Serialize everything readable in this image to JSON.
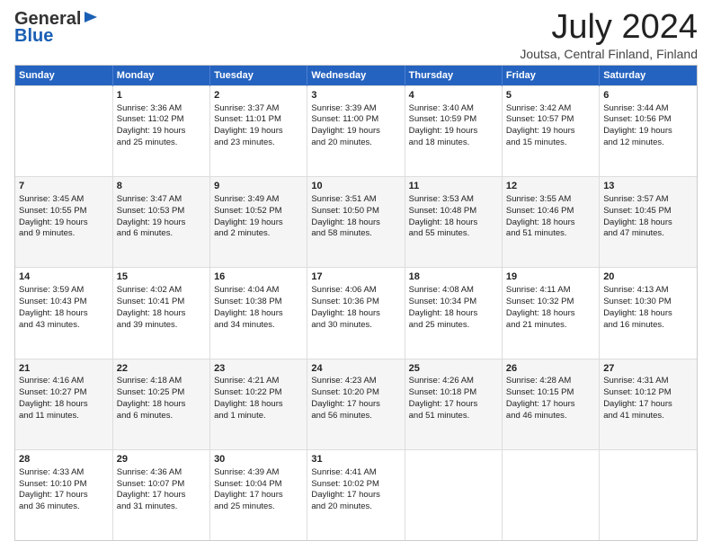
{
  "header": {
    "logo_line1": "General",
    "logo_line2": "Blue",
    "month": "July 2024",
    "location": "Joutsa, Central Finland, Finland"
  },
  "weekdays": [
    "Sunday",
    "Monday",
    "Tuesday",
    "Wednesday",
    "Thursday",
    "Friday",
    "Saturday"
  ],
  "weeks": [
    [
      {
        "day": "",
        "lines": []
      },
      {
        "day": "1",
        "lines": [
          "Sunrise: 3:36 AM",
          "Sunset: 11:02 PM",
          "Daylight: 19 hours",
          "and 25 minutes."
        ]
      },
      {
        "day": "2",
        "lines": [
          "Sunrise: 3:37 AM",
          "Sunset: 11:01 PM",
          "Daylight: 19 hours",
          "and 23 minutes."
        ]
      },
      {
        "day": "3",
        "lines": [
          "Sunrise: 3:39 AM",
          "Sunset: 11:00 PM",
          "Daylight: 19 hours",
          "and 20 minutes."
        ]
      },
      {
        "day": "4",
        "lines": [
          "Sunrise: 3:40 AM",
          "Sunset: 10:59 PM",
          "Daylight: 19 hours",
          "and 18 minutes."
        ]
      },
      {
        "day": "5",
        "lines": [
          "Sunrise: 3:42 AM",
          "Sunset: 10:57 PM",
          "Daylight: 19 hours",
          "and 15 minutes."
        ]
      },
      {
        "day": "6",
        "lines": [
          "Sunrise: 3:44 AM",
          "Sunset: 10:56 PM",
          "Daylight: 19 hours",
          "and 12 minutes."
        ]
      }
    ],
    [
      {
        "day": "7",
        "lines": [
          "Sunrise: 3:45 AM",
          "Sunset: 10:55 PM",
          "Daylight: 19 hours",
          "and 9 minutes."
        ]
      },
      {
        "day": "8",
        "lines": [
          "Sunrise: 3:47 AM",
          "Sunset: 10:53 PM",
          "Daylight: 19 hours",
          "and 6 minutes."
        ]
      },
      {
        "day": "9",
        "lines": [
          "Sunrise: 3:49 AM",
          "Sunset: 10:52 PM",
          "Daylight: 19 hours",
          "and 2 minutes."
        ]
      },
      {
        "day": "10",
        "lines": [
          "Sunrise: 3:51 AM",
          "Sunset: 10:50 PM",
          "Daylight: 18 hours",
          "and 58 minutes."
        ]
      },
      {
        "day": "11",
        "lines": [
          "Sunrise: 3:53 AM",
          "Sunset: 10:48 PM",
          "Daylight: 18 hours",
          "and 55 minutes."
        ]
      },
      {
        "day": "12",
        "lines": [
          "Sunrise: 3:55 AM",
          "Sunset: 10:46 PM",
          "Daylight: 18 hours",
          "and 51 minutes."
        ]
      },
      {
        "day": "13",
        "lines": [
          "Sunrise: 3:57 AM",
          "Sunset: 10:45 PM",
          "Daylight: 18 hours",
          "and 47 minutes."
        ]
      }
    ],
    [
      {
        "day": "14",
        "lines": [
          "Sunrise: 3:59 AM",
          "Sunset: 10:43 PM",
          "Daylight: 18 hours",
          "and 43 minutes."
        ]
      },
      {
        "day": "15",
        "lines": [
          "Sunrise: 4:02 AM",
          "Sunset: 10:41 PM",
          "Daylight: 18 hours",
          "and 39 minutes."
        ]
      },
      {
        "day": "16",
        "lines": [
          "Sunrise: 4:04 AM",
          "Sunset: 10:38 PM",
          "Daylight: 18 hours",
          "and 34 minutes."
        ]
      },
      {
        "day": "17",
        "lines": [
          "Sunrise: 4:06 AM",
          "Sunset: 10:36 PM",
          "Daylight: 18 hours",
          "and 30 minutes."
        ]
      },
      {
        "day": "18",
        "lines": [
          "Sunrise: 4:08 AM",
          "Sunset: 10:34 PM",
          "Daylight: 18 hours",
          "and 25 minutes."
        ]
      },
      {
        "day": "19",
        "lines": [
          "Sunrise: 4:11 AM",
          "Sunset: 10:32 PM",
          "Daylight: 18 hours",
          "and 21 minutes."
        ]
      },
      {
        "day": "20",
        "lines": [
          "Sunrise: 4:13 AM",
          "Sunset: 10:30 PM",
          "Daylight: 18 hours",
          "and 16 minutes."
        ]
      }
    ],
    [
      {
        "day": "21",
        "lines": [
          "Sunrise: 4:16 AM",
          "Sunset: 10:27 PM",
          "Daylight: 18 hours",
          "and 11 minutes."
        ]
      },
      {
        "day": "22",
        "lines": [
          "Sunrise: 4:18 AM",
          "Sunset: 10:25 PM",
          "Daylight: 18 hours",
          "and 6 minutes."
        ]
      },
      {
        "day": "23",
        "lines": [
          "Sunrise: 4:21 AM",
          "Sunset: 10:22 PM",
          "Daylight: 18 hours",
          "and 1 minute."
        ]
      },
      {
        "day": "24",
        "lines": [
          "Sunrise: 4:23 AM",
          "Sunset: 10:20 PM",
          "Daylight: 17 hours",
          "and 56 minutes."
        ]
      },
      {
        "day": "25",
        "lines": [
          "Sunrise: 4:26 AM",
          "Sunset: 10:18 PM",
          "Daylight: 17 hours",
          "and 51 minutes."
        ]
      },
      {
        "day": "26",
        "lines": [
          "Sunrise: 4:28 AM",
          "Sunset: 10:15 PM",
          "Daylight: 17 hours",
          "and 46 minutes."
        ]
      },
      {
        "day": "27",
        "lines": [
          "Sunrise: 4:31 AM",
          "Sunset: 10:12 PM",
          "Daylight: 17 hours",
          "and 41 minutes."
        ]
      }
    ],
    [
      {
        "day": "28",
        "lines": [
          "Sunrise: 4:33 AM",
          "Sunset: 10:10 PM",
          "Daylight: 17 hours",
          "and 36 minutes."
        ]
      },
      {
        "day": "29",
        "lines": [
          "Sunrise: 4:36 AM",
          "Sunset: 10:07 PM",
          "Daylight: 17 hours",
          "and 31 minutes."
        ]
      },
      {
        "day": "30",
        "lines": [
          "Sunrise: 4:39 AM",
          "Sunset: 10:04 PM",
          "Daylight: 17 hours",
          "and 25 minutes."
        ]
      },
      {
        "day": "31",
        "lines": [
          "Sunrise: 4:41 AM",
          "Sunset: 10:02 PM",
          "Daylight: 17 hours",
          "and 20 minutes."
        ]
      },
      {
        "day": "",
        "lines": []
      },
      {
        "day": "",
        "lines": []
      },
      {
        "day": "",
        "lines": []
      }
    ]
  ]
}
